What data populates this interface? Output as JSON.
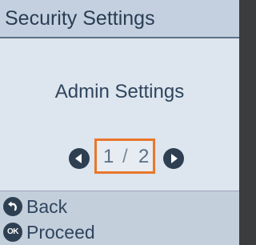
{
  "header": {
    "title": "Security Settings"
  },
  "main": {
    "selected_item": "Admin Settings",
    "pager": {
      "current": "1",
      "separator": "/",
      "total": "2"
    }
  },
  "footer": {
    "back_label": "Back",
    "back_icon": "back-arrow-icon",
    "proceed_label": "Proceed",
    "proceed_icon_text": "OK"
  },
  "colors": {
    "accent": "#e9772b",
    "text": "#2f455e",
    "button": "#2f3f52"
  }
}
